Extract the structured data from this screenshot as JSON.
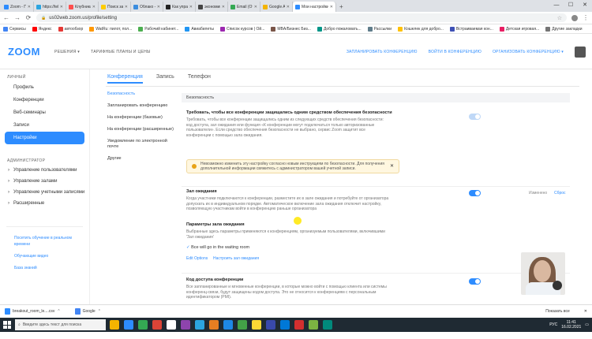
{
  "browser": {
    "tabs": [
      {
        "label": "Zoom - Персональное",
        "fav": "#2d8cff"
      },
      {
        "label": "https://telegram...",
        "fav": "#2ca5e0"
      },
      {
        "label": "Клубника: Ваш ассистен...",
        "fav": "#ff4f4f"
      },
      {
        "label": "Поиск закзов | Я...",
        "fav": "#ffcc00"
      },
      {
        "label": "Облако - вход в...",
        "fav": "#3c8dde"
      },
      {
        "label": "Как управлять ассист...",
        "fav": "#222222"
      },
      {
        "label": "экономика прокачк...",
        "fav": "#444444"
      },
      {
        "label": "Email (Отключ) - Входящие",
        "fav": "#34a853"
      },
      {
        "label": "Google Analytics",
        "fav": "#f4b400"
      },
      {
        "label": "Мои настройки - Zoom",
        "fav": "#2d8cff"
      }
    ],
    "active_tab": 9,
    "url": "us02web.zoom.us/profile/setting",
    "bookmarks": [
      "Сервисы",
      "Яндекс",
      "автообзор",
      "WatRu: пилот, пол...",
      "Рабочий кабинет...",
      "Авиабилеты",
      "Список курсов | Ой...",
      "MBA/Бизнес Биз...",
      "Добро пожаловать...",
      "Рассылки",
      "Кошелек для добро...",
      "Встраиваемая кон...",
      "Детская игровая...",
      "Другие закладки"
    ],
    "bookmark_colors": [
      "#4285f4",
      "#ff0000",
      "#e53935",
      "#ff9800",
      "#4caf50",
      "#2196f3",
      "#9c27b0",
      "#795548",
      "#009688",
      "#607d8b",
      "#ffc107",
      "#3f51b5",
      "#e91e63",
      "#757575"
    ]
  },
  "zoom_header": {
    "logo": "ZOOM",
    "solutions": "РЕШЕНИЯ ▾",
    "plans": "ТАРИФНЫЕ ПЛАНЫ И ЦЕНЫ",
    "schedule": "ЗАПЛАНИРОВАТЬ КОНФЕРЕНЦИЮ",
    "join": "ВОЙТИ В КОНФЕРЕНЦИЮ",
    "host": "ОРГАНИЗОВАТЬ КОНФЕРЕНЦИЮ ▾"
  },
  "sidebar": {
    "personal_heading": "ЛИЧНЫЙ",
    "items": [
      "Профиль",
      "Конференции",
      "Веб-семинары",
      "Записи",
      "Настройки"
    ],
    "active_index": 4,
    "admin_heading": "АДМИНИСТРАТОР",
    "admin_items": [
      "Управление пользователями",
      "Управление залами",
      "Управление учетными записями",
      "Расширенные"
    ],
    "links": [
      "Посетить обучение в реальном времени",
      "Обучающие видео",
      "База знаний"
    ]
  },
  "main": {
    "tabs": [
      "Конференция",
      "Запись",
      "Телефон"
    ],
    "active_tab": 0,
    "subnav": [
      "Безопасность",
      "Запланировать конференцию",
      "На конференции (базовые)",
      "На конференции (расширенные)",
      "Уведомление по электронной почте",
      "Другие"
    ],
    "section_header": "Безопасность",
    "setting1_title": "Требовать, чтобы все конференции защищались одним средством обеспечения безопасности",
    "setting1_desc": "Требовать, чтобы все конференции защищались одним из следующих средств обеспечения безопасности: код доступа, зал ожидания или функция «К конференции могут подключаться только авторизованные пользователи». Если средство обеспечения безопасности не выбрано, сервис Zoom защитит все конференции с помощью зала ожидания.",
    "warning": "Невозможно изменить эту настройку согласно новым инструкциям по безопасности. Для получения дополнительной информации свяжитесь с администратором вашей учетной записи.",
    "setting2_title": "Зал ожидания",
    "setting2_desc": "Когда участники подключаются к конференции, разместите их в зале ожидания и потребуйте от организатора допускать их в индивидуальном порядке. Автоматическое включение зала ожидания отключит настройку, позволяющую участникам войти в конференцию раньше организатора",
    "changed_label": "Изменено",
    "reset_label": "Сброс",
    "waiting_options_title": "Параметры зала ожидания",
    "waiting_options_desc": "Выбранные здесь параметры применяются к конференциям, организуемым пользователями, включившими 'Зал ожидания'",
    "check_item": "Все will go in the waiting room",
    "edit_options": "Edit Options",
    "customize": "Настроить зал ожидания",
    "setting3_title": "Код доступа конференции",
    "setting3_desc": "Все запланированные и мгновенные конференции, в которые можно войти с помощью клиента или системы конференц-связи, будут защищены кодом доступа. Это не относится к конференциям с персональным идентификатором (PMI)."
  },
  "downloads": {
    "items": [
      "breakout_room_le....csv",
      "Google"
    ],
    "show_all": "Показать все"
  },
  "taskbar": {
    "search_placeholder": "Введите здесь текст для поиска",
    "lang": "РУС",
    "time": "11:41",
    "date": "16.02.2021",
    "app_colors": [
      "#f4b400",
      "#2d8cff",
      "#34a853",
      "#db4437",
      "#ffffff",
      "#8e44ad",
      "#2ca5e0",
      "#e67e22",
      "#1e88e5",
      "#43a047",
      "#fdd835",
      "#3949ab",
      "#0078d7",
      "#d32f2f",
      "#7cb342",
      "#00897b"
    ]
  }
}
